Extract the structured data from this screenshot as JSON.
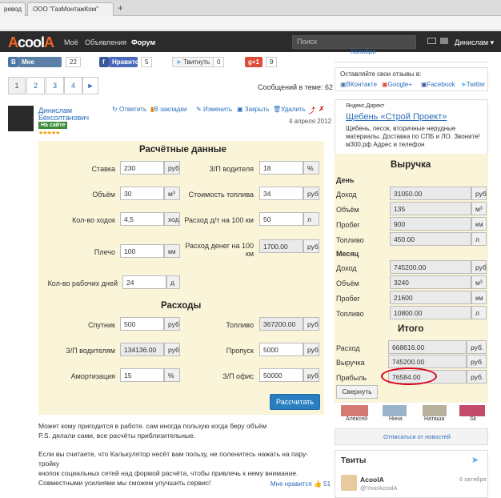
{
  "browser": {
    "tab1": "ревод",
    "tab2": "ООО \"ГазМонтажКом\"",
    "newtab": "+"
  },
  "nav": {
    "logo_a": "A",
    "logo_rest": "cool",
    "logo_a2": "A",
    "links": [
      "Моё",
      "Объявления",
      "Форум"
    ],
    "search_placeholder": "Поиск",
    "user": "Динислам ▾"
  },
  "share": {
    "vk": "В",
    "vk_label": "Мне нравится",
    "vk_count": "22",
    "fb": "f",
    "fb_label": "Нравится",
    "fb_count": "5",
    "tw_label": "Твитнуть",
    "tw_count": "0",
    "gp": "g+1",
    "gp_count": "9"
  },
  "pager": {
    "pages": [
      "1",
      "2",
      "3",
      "4",
      "►"
    ],
    "messages": "Сообщений в теме: 62"
  },
  "post": {
    "author1": "Динислам",
    "author2": "Бексолтанович",
    "badge": "На сайте",
    "stars": "★★★★★",
    "reply": "Ответить",
    "bookmark": "В закладки",
    "edit": "Изменить",
    "close": "Закрыть",
    "delete": "Удалить",
    "date": "4 апреля 2012"
  },
  "calc": {
    "title": "Расчётные данные",
    "rate_l": "Ставка",
    "rate_v": "230",
    "rate_u": "руб",
    "volume_l": "Объём",
    "volume_v": "30",
    "volume_u": "м³",
    "trips_l": "Кол-во ходок",
    "trips_v": "4,5",
    "trips_u": "ход",
    "arm_l": "Плечо",
    "arm_v": "100",
    "arm_u": "км",
    "days_l": "Кол-во рабочих дней",
    "days_v": "24",
    "days_u": "д",
    "salary_l": "З/П водителя",
    "salary_v": "18",
    "salary_u": "%",
    "fuelcost_l": "Стоимость топлива",
    "fuelcost_v": "34",
    "fuelcost_u": "руб",
    "fuelper_l": "Расход д/т на 100 км",
    "fuelper_v": "50",
    "fuelper_u": "л",
    "moneyper_l1": "Расход денег на 100",
    "moneyper_l2": "км",
    "moneyper_v": "1700.00",
    "moneyper_u": "руб",
    "expenses": "Расходы",
    "sat_l": "Спутник",
    "sat_v": "500",
    "sat_u": "руб",
    "drv_l": "З/П водителям",
    "drv_v": "134136.00",
    "drv_u": "руб",
    "amort_l": "Амортизация",
    "amort_v": "15",
    "amort_u": "%",
    "fuel_l": "Топливо",
    "fuel_v": "367200.00",
    "fuel_u": "руб",
    "pass_l": "Пропуск",
    "pass_v": "5000",
    "pass_u": "руб",
    "office_l": "З/П офис",
    "office_v": "50000",
    "office_u": "руб",
    "button": "Рассчитать"
  },
  "text": {
    "p1a": "Может кому пригодится в работе. сам иногда пользую когда беру объём",
    "p1b": "P.S. делали сами, все расчёты приблизительные.",
    "p2a": "Если вы считаете, что Калькулятор несёт вам пользу, не поленитесь нажать на пару-тройку",
    "p2b": "кнопок социальных сетей над формой расчёта, чтобы привлечь к нему внимание.",
    "p2c": "Совместными усилиями мы сможем улучшить сервис!",
    "likes": "Мне нравится",
    "likes_n": "51"
  },
  "sidebar": {
    "top_link": "Калабри",
    "review": "Оставляйте свои отзывы в:",
    "vk": "ВКонтакте",
    "gp": "Google+",
    "fb": "Facebook",
    "tw": "Twitter",
    "ad_label": "Яндекс.Директ",
    "ad_title": "Щебень «Строй Проект»",
    "ad_t1": "Щебень, песок, вторичные нерудные",
    "ad_t2": "материалы. Доставка по СПБ и ЛО. Звоните!",
    "ad_t3": "м300.рф   Адрес и телефон",
    "revenue": "Выручка",
    "day": "День",
    "month": "Месяц",
    "d_income_l": "Доход",
    "d_income_v": "31050.00",
    "d_income_u": "руб",
    "d_vol_l": "Объём",
    "d_vol_v": "135",
    "d_vol_u": "м³",
    "d_run_l": "Пробег",
    "d_run_v": "900",
    "d_run_u": "км",
    "d_fuel_l": "Топливо",
    "d_fuel_v": "450.00",
    "d_fuel_u": "л",
    "m_income_l": "Доход",
    "m_income_v": "745200.00",
    "m_income_u": "руб",
    "m_vol_l": "Объём",
    "m_vol_v": "3240",
    "m_vol_u": "м³",
    "m_run_l": "Пробег",
    "m_run_v": "21600",
    "m_run_u": "км",
    "m_fuel_l": "Топливо",
    "m_fuel_v": "10800.00",
    "m_fuel_u": "л",
    "total": "Итого",
    "t_exp_l": "Расход",
    "t_exp_v": "668616.00",
    "t_exp_u": "руб.",
    "t_rev_l": "Выручка",
    "t_rev_v": "745200.00",
    "t_rev_u": "руб.",
    "t_profit_l": "Прибыль",
    "t_profit_v": "76584.00",
    "t_profit_u": "руб.",
    "collapse": "Свернуть",
    "friends": [
      "Алексей",
      "Нина",
      "Наташа",
      "Sk"
    ],
    "unsubscribe": "Отписаться от новостей",
    "tweets": "Твиты",
    "tw_name": "AcoolA",
    "tw_handle": "@YourAcoolA",
    "tw_date": "6 октября"
  },
  "colors": {
    "accent": "#2a7fc1",
    "nav_bg": "#2b2b2b",
    "panel": "#faf4d8",
    "logo": "#f26522",
    "profit_circle": "#d9001b"
  }
}
